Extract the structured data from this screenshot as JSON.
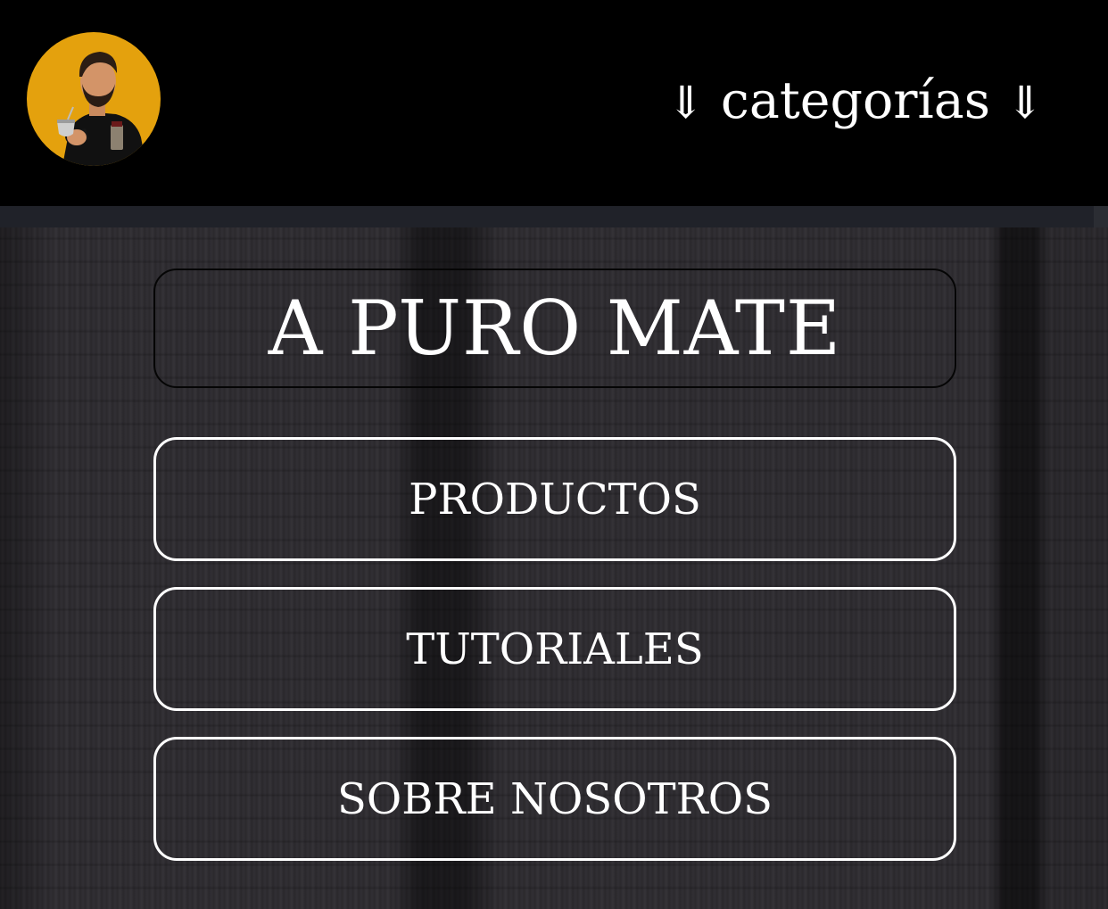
{
  "header": {
    "logo_alt": "man holding mate",
    "nav_label": "categorías",
    "nav_arrow": "⇓",
    "logo_bg_color": "#e4a10d"
  },
  "main": {
    "title": "A PURO MATE",
    "menu": [
      {
        "label": "PRODUCTOS"
      },
      {
        "label": "TUTORIALES"
      },
      {
        "label": "SOBRE NOSOTROS"
      }
    ]
  }
}
